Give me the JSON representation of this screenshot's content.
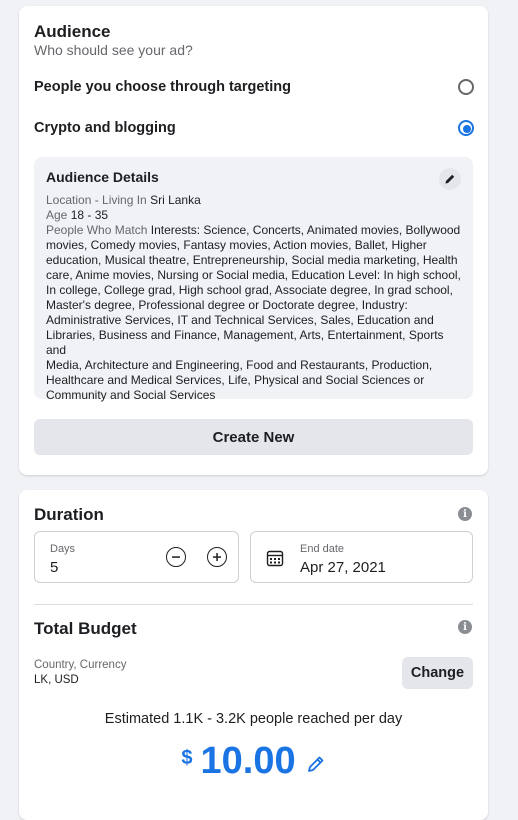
{
  "audience": {
    "title": "Audience",
    "subtitle": "Who should see your ad?",
    "options": [
      {
        "label": "People you choose through targeting",
        "selected": false
      },
      {
        "label": "Crypto and blogging",
        "selected": true
      }
    ],
    "details": {
      "title": "Audience Details",
      "location_key": "Location - Living In",
      "location_value": "Sri Lanka",
      "age_key": "Age",
      "age_value": "18 - 35",
      "match_key": "People Who Match",
      "match_value_lines": [
        "Interests: Science, Concerts, Animated movies, Bollywood",
        "movies, Comedy movies, Fantasy movies, Action movies, Ballet, Higher",
        "education, Musical theatre, Entrepreneurship, Social media marketing, Health",
        "care, Anime movies, Nursing or Social media, Education Level: In high school,",
        "In college, College grad, High school grad, Associate degree, In grad school,",
        "Master's degree, Professional degree or Doctorate degree, Industry:",
        "Administrative Services, IT and Technical Services, Sales, Education and",
        "Libraries, Business and Finance, Management, Arts, Entertainment, Sports and",
        "Media, Architecture and Engineering, Food and Restaurants, Production,",
        "Healthcare and Medical Services, Life, Physical and Social Sciences or",
        "Community and Social Services"
      ]
    },
    "create_label": "Create New"
  },
  "duration": {
    "title": "Duration",
    "days_label": "Days",
    "days_value": "5",
    "end_label": "End date",
    "end_value": "Apr 27, 2021"
  },
  "budget": {
    "title": "Total Budget",
    "country_label": "Country, Currency",
    "country_value": "LK, USD",
    "change_label": "Change",
    "estimate": "Estimated 1.1K - 3.2K people reached per day",
    "currency_symbol": "$",
    "amount": "10.00"
  },
  "colors": {
    "accent": "#1b74e4",
    "background": "#f0f2f5",
    "button_gray": "#e4e6eb"
  },
  "icons": [
    "pencil-icon",
    "info-icon",
    "minus-circle-icon",
    "plus-circle-icon",
    "calendar-icon"
  ]
}
